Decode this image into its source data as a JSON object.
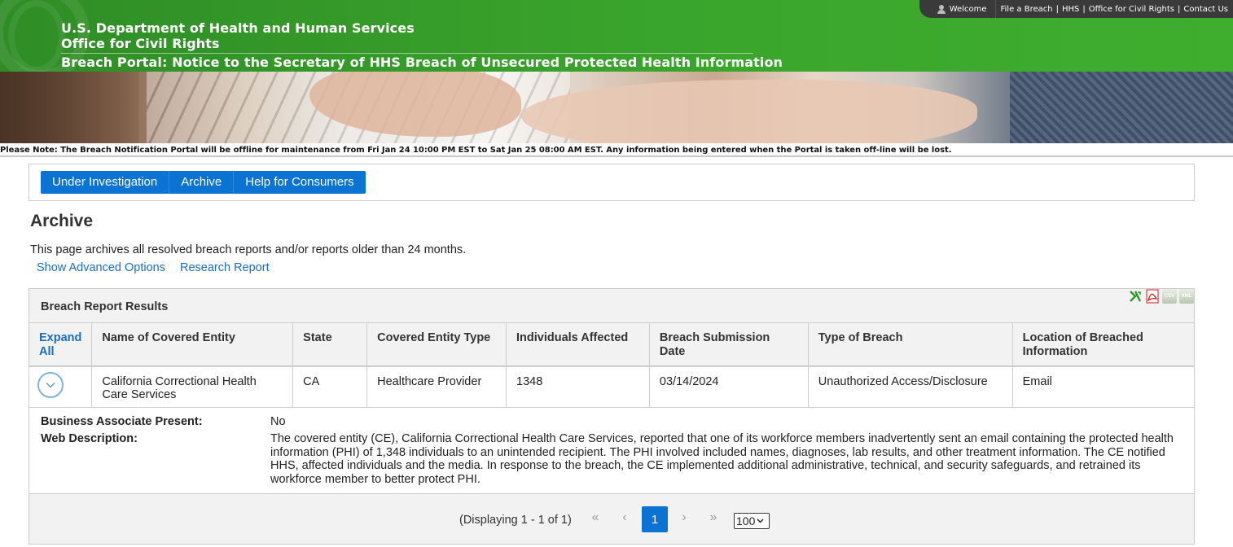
{
  "header": {
    "line1": "U.S. Department of Health and Human Services",
    "line2": "Office for Civil Rights",
    "line3": "Breach Portal: Notice to the Secretary of HHS Breach of Unsecured Protected Health Information"
  },
  "toplinks": {
    "welcome": "Welcome",
    "file_breach": "File a Breach",
    "hhs": "HHS",
    "ocr": "Office for Civil Rights",
    "contact": "Contact Us",
    "separator": "|"
  },
  "notice": "Please Note: The Breach Notification Portal will be offline for maintenance from Fri Jan 24 10:00 PM EST to Sat Jan 25 08:00 AM EST. Any information being entered when the Portal is taken off-line will be lost.",
  "nav": {
    "items": [
      "Under Investigation",
      "Archive",
      "Help for Consumers"
    ]
  },
  "page": {
    "title": "Archive",
    "intro": "This page archives all resolved breach reports and/or reports older than 24 months.",
    "link_advanced": "Show Advanced Options",
    "link_research": "Research Report"
  },
  "results": {
    "title": "Breach Report Results",
    "exports": {
      "excel_icon": "excel-icon",
      "pdf_icon": "pdf-icon",
      "csv_label": "CSV",
      "xml_label": "XML"
    },
    "columns": [
      "Expand All",
      "Name of Covered Entity",
      "State",
      "Covered Entity Type",
      "Individuals Affected",
      "Breach Submission Date",
      "Type of Breach",
      "Location of Breached Information"
    ],
    "rows": [
      {
        "name": "California Correctional Health Care Services",
        "state": "CA",
        "entity_type": "Healthcare Provider",
        "individuals": "1348",
        "date": "03/14/2024",
        "breach_type": "Unauthorized Access/Disclosure",
        "location": "Email"
      }
    ],
    "details": {
      "ba_label": "Business Associate Present:",
      "ba_value": "No",
      "desc_label": "Web Description:",
      "desc_value": "The covered entity (CE), California Correctional Health Care Services, reported that one of its workforce members inadvertently sent an email containing the protected health information (PHI) of 1,348 individuals to an unintended recipient. The PHI involved included names, diagnoses, lab results, and other treatment information. The CE notified HHS, affected individuals and the media. In response to the breach, the CE implemented additional administrative, technical, and security safeguards, and retrained its workforce member to better protect PHI."
    }
  },
  "pager": {
    "display": "(Displaying 1 - 1 of 1)",
    "first": "«",
    "prev": "‹",
    "current": "1",
    "next": "›",
    "last": "»",
    "page_size": "100"
  },
  "colors": {
    "header_green": "#3aa52c",
    "nav_blue": "#0b73d1",
    "link_blue": "#1a6fc4"
  }
}
